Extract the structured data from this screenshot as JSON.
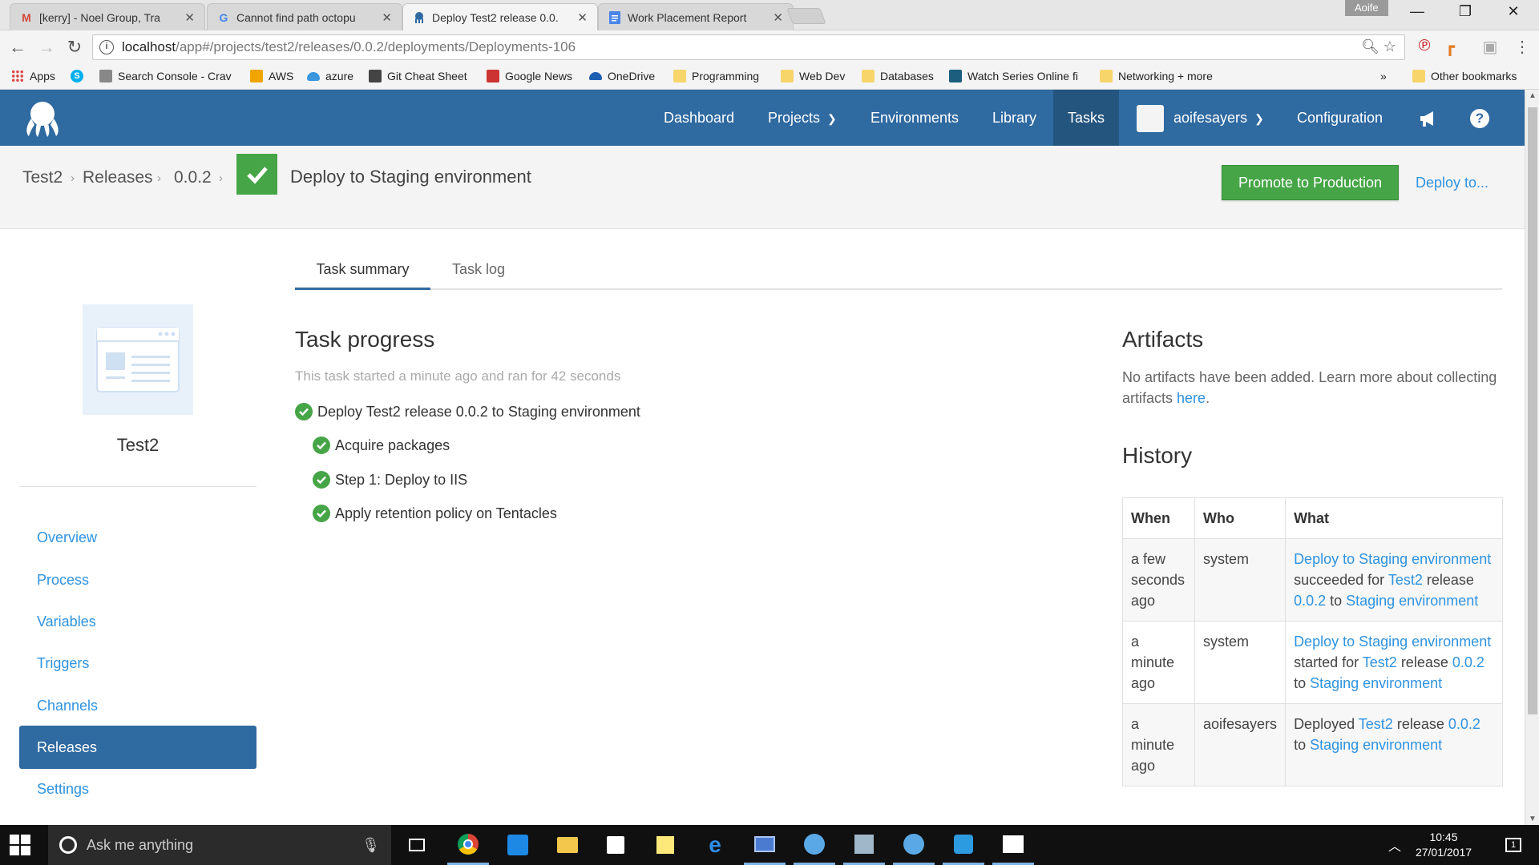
{
  "browser": {
    "profile": "Aoife",
    "tabs": [
      {
        "title": "[kerry] - Noel Group, Tra",
        "icon": "gmail-icon",
        "active": false
      },
      {
        "title": "Cannot find path octopu",
        "icon": "google-icon",
        "active": false
      },
      {
        "title": "Deploy Test2 release 0.0.",
        "icon": "octopus-icon",
        "active": true
      },
      {
        "title": "Work Placement Report",
        "icon": "docs-icon",
        "active": false
      }
    ],
    "url_host": "localhost",
    "url_path": "/app#/projects/test2/releases/0.0.2/deployments/Deployments-106",
    "bookmarks": [
      {
        "label": "Apps",
        "icon": "apps-grid-icon"
      },
      {
        "label": "",
        "icon": "skype-icon"
      },
      {
        "label": "Search Console - Crav",
        "icon": "search-console-icon"
      },
      {
        "label": "AWS",
        "icon": "aws-icon"
      },
      {
        "label": "azure",
        "icon": "azure-icon"
      },
      {
        "label": "Git Cheat Sheet",
        "icon": "git-icon"
      },
      {
        "label": "Google News",
        "icon": "news-icon"
      },
      {
        "label": "OneDrive",
        "icon": "onedrive-icon"
      },
      {
        "label": "Programming",
        "icon": "folder-icon"
      },
      {
        "label": "Web Dev",
        "icon": "folder-icon"
      },
      {
        "label": "Databases",
        "icon": "folder-icon"
      },
      {
        "label": "Watch Series Online fi",
        "icon": "watch-series-icon"
      },
      {
        "label": "Networking + more",
        "icon": "folder-icon"
      }
    ],
    "bookmarks_overflow": "»",
    "other_bookmarks": "Other bookmarks"
  },
  "nav": {
    "items": [
      "Dashboard",
      "Projects",
      "Environments",
      "Library",
      "Tasks"
    ],
    "active": "Tasks",
    "user": "aoifesayers",
    "configuration": "Configuration"
  },
  "breadcrumb": [
    "Test2",
    "Releases",
    "0.0.2"
  ],
  "page_title": "Deploy to Staging environment",
  "actions": {
    "promote": "Promote to Production",
    "deploy_to": "Deploy to..."
  },
  "project": {
    "name": "Test2"
  },
  "sidebar": {
    "items": [
      "Overview",
      "Process",
      "Variables",
      "Triggers",
      "Channels",
      "Releases",
      "Settings"
    ],
    "active": "Releases"
  },
  "tabs": {
    "summary": "Task summary",
    "log": "Task log"
  },
  "task": {
    "title": "Task progress",
    "subtitle": "This task started a minute ago and ran for 42 seconds",
    "root": "Deploy Test2 release 0.0.2 to Staging environment",
    "steps": [
      "Acquire packages",
      "Step 1: Deploy to IIS",
      "Apply retention policy on Tentacles"
    ]
  },
  "artifacts": {
    "title": "Artifacts",
    "text": "No artifacts have been added. Learn more about collecting artifacts ",
    "link": "here",
    "after_link": "."
  },
  "history": {
    "title": "History",
    "columns": [
      "When",
      "Who",
      "What"
    ],
    "rows": [
      {
        "when": "a few seconds ago",
        "who": "system",
        "what": [
          {
            "t": "Deploy to Staging environment",
            "l": true
          },
          {
            "t": " succeeded for ",
            "l": false
          },
          {
            "t": "Test2",
            "l": true
          },
          {
            "t": " release ",
            "l": false
          },
          {
            "t": "0.0.2",
            "l": true
          },
          {
            "t": " to ",
            "l": false
          },
          {
            "t": "Staging environment",
            "l": true
          }
        ]
      },
      {
        "when": "a minute ago",
        "who": "system",
        "what": [
          {
            "t": "Deploy to Staging environment",
            "l": true
          },
          {
            "t": " started for ",
            "l": false
          },
          {
            "t": "Test2",
            "l": true
          },
          {
            "t": " release ",
            "l": false
          },
          {
            "t": "0.0.2",
            "l": true
          },
          {
            "t": " to ",
            "l": false
          },
          {
            "t": "Staging environment",
            "l": true
          }
        ]
      },
      {
        "when": "a minute ago",
        "who": "aoifesayers",
        "what": [
          {
            "t": "Deployed ",
            "l": false
          },
          {
            "t": "Test2",
            "l": true
          },
          {
            "t": " release ",
            "l": false
          },
          {
            "t": "0.0.2",
            "l": true
          },
          {
            "t": " to ",
            "l": false
          },
          {
            "t": "Staging environment",
            "l": true
          }
        ]
      }
    ]
  },
  "taskbar": {
    "search_placeholder": "Ask me anything",
    "time": "10:45",
    "date": "27/01/2017",
    "notifications": "1",
    "apps": [
      "chrome-icon",
      "blue-app-icon",
      "file-explorer-icon",
      "store-icon",
      "sticky-notes-icon",
      "edge-icon",
      "remote-desktop-icon",
      "octopus-tentacle-icon",
      "package-icon",
      "octopus-server-icon",
      "paint-icon",
      "photos-icon"
    ]
  },
  "colors": {
    "brand": "#2f6aa1",
    "brand_dark": "#24557f",
    "success": "#46a546",
    "link": "#2f93e0"
  }
}
